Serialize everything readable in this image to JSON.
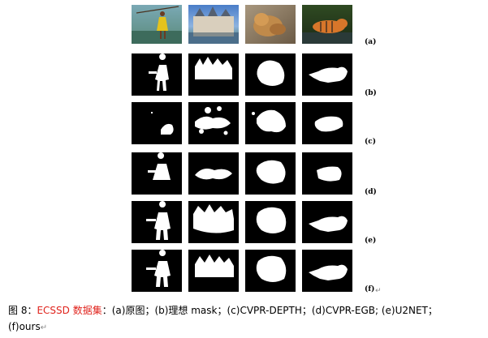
{
  "figure": {
    "row_labels": [
      "(a)",
      "(b)",
      "(c)",
      "(d)",
      "(e)",
      "(f)"
    ],
    "column_subjects": [
      "girl",
      "castle",
      "lion",
      "tiger"
    ],
    "row_contents": [
      "original-image",
      "ground-truth-mask",
      "CVPR-DEPTH",
      "CVPR-EGB",
      "U2NET",
      "ours"
    ]
  },
  "caption": {
    "prefix": "图 8：",
    "dataset": "ECSSD 数据集",
    "colon": "：",
    "items": "(a)原图；(b)理想 mask；(c)CVPR-DEPTH；(d)CVPR-EGB; (e)U2NET；",
    "line2": "(f)ours",
    "return_mark": "↵"
  },
  "colors": {
    "caption_red": "#e0231c",
    "mask_fg": "#ffffff",
    "mask_bg": "#000000"
  }
}
